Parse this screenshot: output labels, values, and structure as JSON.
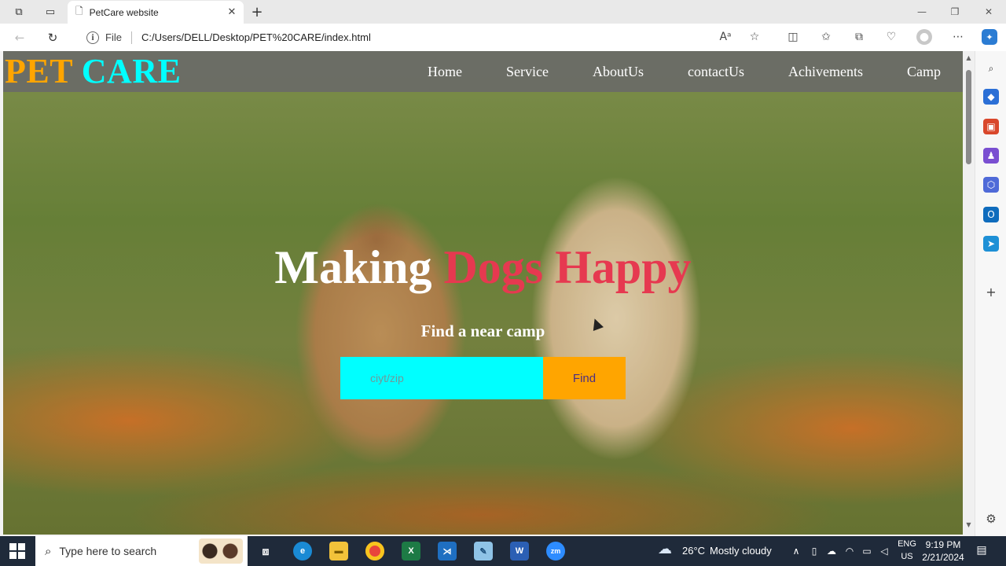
{
  "browser": {
    "tab_title": "PetCare website",
    "file_label": "File",
    "url": "C:/Users/DELL/Desktop/PET%20CARE/index.html"
  },
  "page": {
    "logo_part1": "PET",
    "logo_part2": "CARE",
    "menu": [
      "Home",
      "Service",
      "AboutUs",
      "contactUs",
      "Achivements",
      "Camp"
    ],
    "headline_white": "Making",
    "headline_red": "Dogs Happy",
    "subhead": "Find a near camp",
    "search_placeholder": "ciyt/zip",
    "find_label": "Find",
    "colors": {
      "pet": "#ffa500",
      "care": "#00ffff",
      "headline_red": "#e63950",
      "search_bg": "#00ffff",
      "find_bg": "#ffa500"
    }
  },
  "taskbar": {
    "search_placeholder": "Type here to search",
    "weather_temp": "26°C",
    "weather_text": "Mostly cloudy",
    "lang": "ENG",
    "region": "US",
    "time": "9:19 PM",
    "date": "2/21/2024"
  }
}
